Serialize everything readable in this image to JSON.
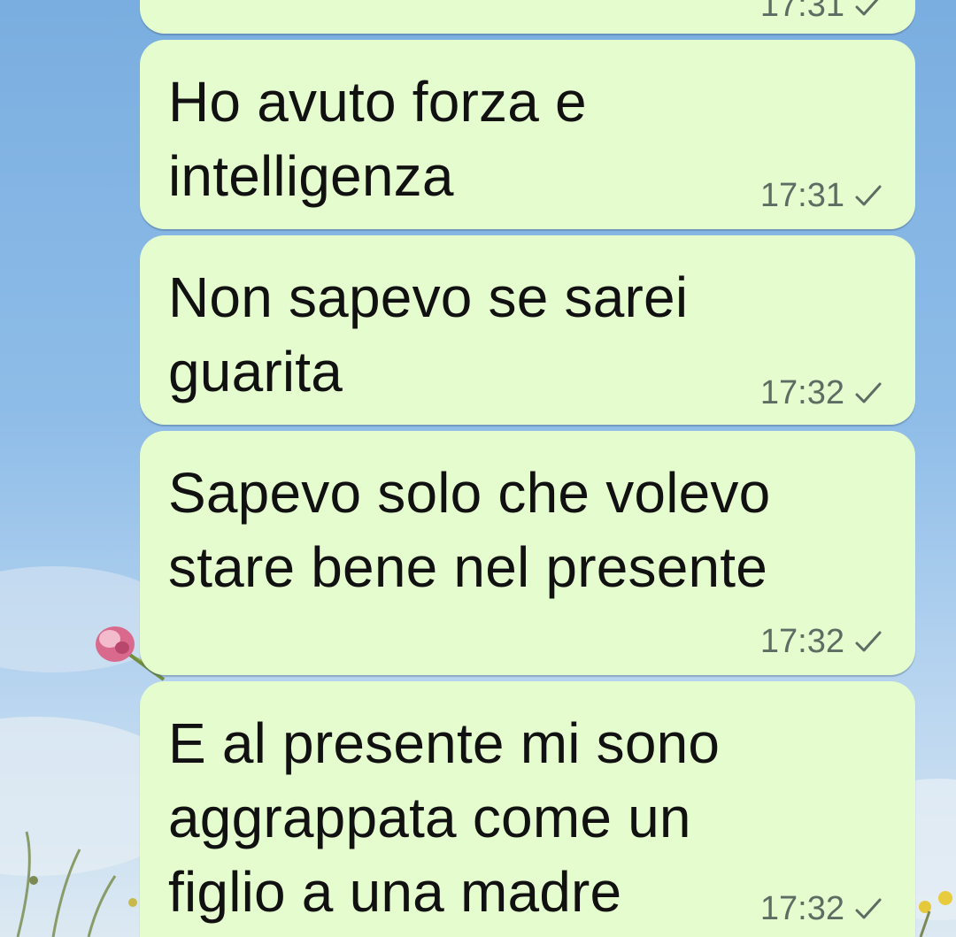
{
  "app": {
    "colors": {
      "outgoing_bubble": "#e5fccf",
      "timestamp": "#5d6d63",
      "wallpaper_sky": "#8dbbe6"
    }
  },
  "messages": [
    {
      "text": "",
      "time": "17:31",
      "status_icon": "single-check-icon",
      "partially_visible": true
    },
    {
      "text": "Ho avuto forza e\nintelligenza",
      "time": "17:31",
      "status_icon": "single-check-icon"
    },
    {
      "text": "Non sapevo se sarei\nguarita",
      "time": "17:32",
      "status_icon": "single-check-icon"
    },
    {
      "text": "Sapevo solo che volevo\nstare bene nel presente",
      "time": "17:32",
      "status_icon": "single-check-icon"
    },
    {
      "text": "E al presente mi sono\naggrappata come un\nfiglio a una madre",
      "time": "17:32",
      "status_icon": "single-check-icon"
    }
  ]
}
